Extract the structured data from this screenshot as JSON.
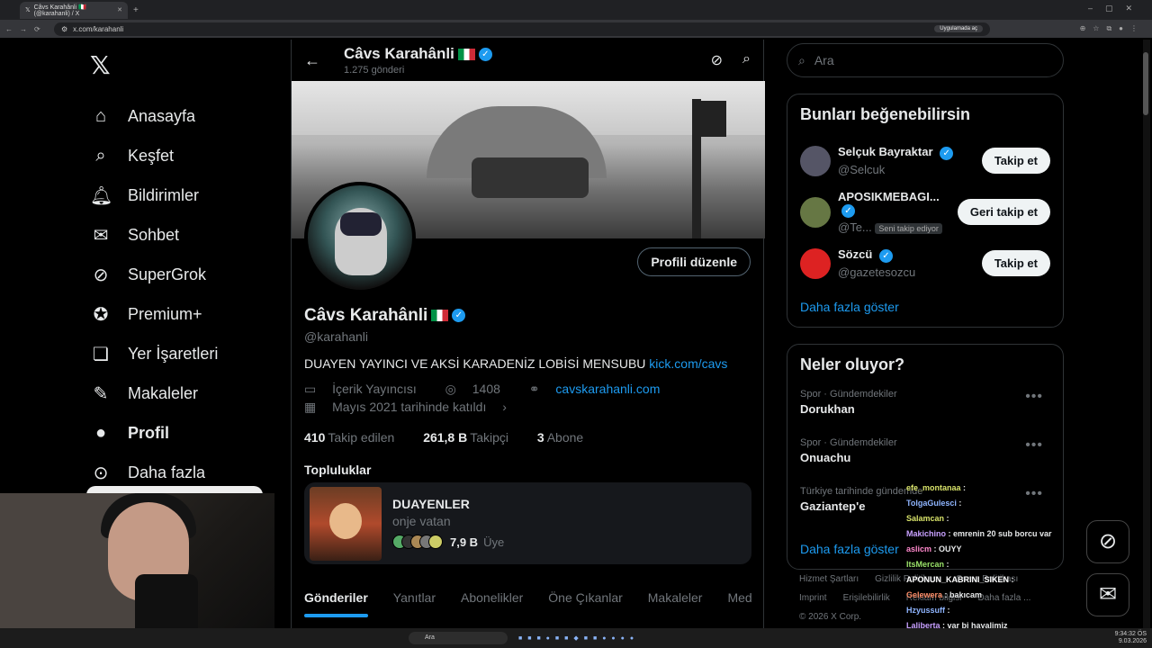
{
  "browser": {
    "tab_title": "Câvs Karahânli 🇮🇹 (@karahanli) / X",
    "url": "x.com/karahanli",
    "open_in_app": "Uygulamada aç"
  },
  "sidebar": {
    "items": [
      {
        "label": "Anasayfa",
        "icon": "home-icon"
      },
      {
        "label": "Keşfet",
        "icon": "search-icon"
      },
      {
        "label": "Bildirimler",
        "icon": "bell-icon"
      },
      {
        "label": "Sohbet",
        "icon": "mail-icon"
      },
      {
        "label": "SuperGrok",
        "icon": "grok-icon"
      },
      {
        "label": "Premium+",
        "icon": "premium-icon"
      },
      {
        "label": "Yer İşaretleri",
        "icon": "bookmark-icon"
      },
      {
        "label": "Makaleler",
        "icon": "article-icon"
      },
      {
        "label": "Profil",
        "icon": "profile-icon"
      },
      {
        "label": "Daha fazla",
        "icon": "more-icon"
      }
    ]
  },
  "header": {
    "name": "Câvs Karahânli",
    "posts": "1.275 gönderi"
  },
  "profile": {
    "edit_button": "Profili düzenle",
    "name": "Câvs Karahânli",
    "handle": "@karahanli",
    "bio": "DUAYEN YAYINCI VE AKSİ KARADENİZ LOBİSİ MENSUBU",
    "bio_link": "kick.com/cavs",
    "category": "İçerik Yayıncısı",
    "location": "1408",
    "website": "cavskarahanli.com",
    "joined": "Mayıs 2021 tarihinde katıldı",
    "following_count": "410",
    "following_label": "Takip edilen",
    "followers_count": "261,8 B",
    "followers_label": "Takipçi",
    "subs_count": "3",
    "subs_label": "Abone"
  },
  "communities": {
    "title": "Topluluklar",
    "name": "DUAYENLER",
    "subtitle": "onje vatan",
    "members": "7,9 B",
    "members_label": "Üye"
  },
  "tabs": [
    "Gönderiler",
    "Yanıtlar",
    "Abonelikler",
    "Öne Çıkanlar",
    "Makaleler",
    "Med"
  ],
  "right": {
    "search_placeholder": "Ara",
    "suggest_title": "Bunları beğenebilirsin",
    "suggestions": [
      {
        "name": "Selçuk Bayraktar",
        "handle": "@Selcuk",
        "button": "Takip et"
      },
      {
        "name": "APOSIKMEBAGI...",
        "handle": "@Te...",
        "badge": "Seni takip ediyor",
        "button": "Geri takip et"
      },
      {
        "name": "Sözcü",
        "handle": "@gazetesozcu",
        "button": "Takip et"
      }
    ],
    "show_more": "Daha fazla göster",
    "trends_title": "Neler oluyor?",
    "trends": [
      {
        "category": "Spor · Gündemdekiler",
        "name": "Dorukhan"
      },
      {
        "category": "Spor · Gündemdekiler",
        "name": "Onuachu"
      },
      {
        "category": "Türkiye tarihinde gündemde",
        "name": "Gaziantep'e"
      }
    ],
    "trends_more": "Daha fazla göster",
    "footer": [
      "Hizmet Şartları",
      "Gizlilik Politikası",
      "Çerez Politikası",
      "Imprint",
      "Erişilebilirlik",
      "Reklam bilgisi",
      "Daha fazla ...",
      "© 2026 X Corp."
    ]
  },
  "chat": [
    {
      "user": "efe_montanaa",
      "msg": "",
      "color": "#d8e36a"
    },
    {
      "user": "TolgaGulesci",
      "msg": "",
      "color": "#8fb5ff"
    },
    {
      "user": "Salamcan",
      "msg": "",
      "color": "#d8e36a"
    },
    {
      "user": "Makichino",
      "msg": "emrenin 20 sub borcu var",
      "color": "#c8a0ff"
    },
    {
      "user": "aslicm",
      "msg": "OUYY",
      "color": "#ff88cc"
    },
    {
      "user": "ItsMercan",
      "msg": "",
      "color": "#9be36a"
    },
    {
      "user": "APONUN_KABRINI_SIKEN",
      "msg": "",
      "color": "#ffffff"
    },
    {
      "user": "Gelewera",
      "msg": "bakıcam",
      "color": "#ff8f6a"
    },
    {
      "user": "Hzyussuff",
      "msg": "",
      "color": "#8fb5ff"
    },
    {
      "user": "Laliberta",
      "msg": "var bi hayalimiz",
      "color": "#c8a0ff"
    }
  ],
  "taskbar": {
    "search": "Ara",
    "time": "9:34:32 ÖS",
    "date": "9.03.2026"
  }
}
